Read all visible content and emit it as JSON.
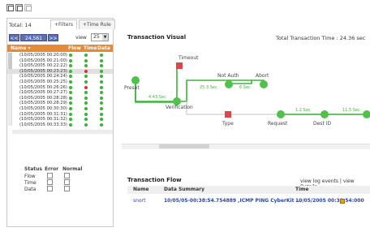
{
  "toolbar": {
    "icons": [
      "window-icon",
      "window-icon",
      "window-icon-disabled"
    ]
  },
  "left": {
    "total_label": "Total: 14",
    "tabs": [
      {
        "label": "+Filters"
      },
      {
        "label": "+Time Rule"
      }
    ],
    "pager": {
      "prev": "<<",
      "page": "24,561",
      "next": ">>"
    },
    "view": {
      "label": "view",
      "value": "25",
      "arrow": "▼"
    },
    "table_header": {
      "name": "Name ▾",
      "flow": "Flow",
      "time": "Time",
      "data": "Data"
    },
    "rows": [
      {
        "ts": "(10/05/2005 00:20:00)",
        "dots": [
          "#36b536",
          "#36b536",
          "#36b536"
        ],
        "selected": false
      },
      {
        "ts": "(10/05/2005 00:21:00)",
        "dots": [
          "#36b536",
          "#36b536",
          "#36b536"
        ],
        "selected": false
      },
      {
        "ts": "(10/05/2005 00:22:22)",
        "dots": [
          "#36b536",
          "#36b536",
          "#36b536"
        ],
        "selected": false
      },
      {
        "ts": "(10/05/2005 00:23:23)",
        "dots": [
          "#36b536",
          "#e03030",
          "#36b536"
        ],
        "selected": true
      },
      {
        "ts": "(10/05/2005 00:24:24)",
        "dots": [
          "#36b536",
          "#36b536",
          "#36b536"
        ],
        "selected": false
      },
      {
        "ts": "(10/05/2005 00:25:25)",
        "dots": [
          "#36b536",
          "#36b536",
          "#36b536"
        ],
        "selected": false
      },
      {
        "ts": "(10/05/2005 00:26:26)",
        "dots": [
          "#36b536",
          "#e03030",
          "#36b536"
        ],
        "selected": false
      },
      {
        "ts": "(10/05/2005 00:27:27)",
        "dots": [
          "#36b536",
          "#36b536",
          "#36b536"
        ],
        "selected": false
      },
      {
        "ts": "(10/05/2005 00:28:28)",
        "dots": [
          "#36b536",
          "#36b536",
          "#36b536"
        ],
        "selected": false
      },
      {
        "ts": "(10/05/2005 00:28:29)",
        "dots": [
          "#36b536",
          "#36b536",
          "#36b536"
        ],
        "selected": false
      },
      {
        "ts": "(10/05/2005 00:30:30)",
        "dots": [
          "#36b536",
          "#36b536",
          "#36b536"
        ],
        "selected": false
      },
      {
        "ts": "(10/05/2005 00:31:31)",
        "dots": [
          "#36b536",
          "#36b536",
          "#36b536"
        ],
        "selected": false
      },
      {
        "ts": "(10/05/2005 00:31:32)",
        "dots": [
          "#36b536",
          "#36b536",
          "#36b536"
        ],
        "selected": false
      },
      {
        "ts": "(10/05/2005 00:33:33)",
        "dots": [
          "#36b536",
          "#36b536",
          "#36b536"
        ],
        "selected": false
      }
    ],
    "legend": {
      "status": "Status",
      "error": "Error",
      "normal": "Normal",
      "items": [
        "Flow",
        "Time",
        "Data"
      ]
    }
  },
  "visual": {
    "title": "Transaction Visual",
    "total_time": "Total Transaction Time : 24.36 sec",
    "nodes": {
      "preset": "Preset",
      "timeout": "Timeout",
      "verification": "Verification",
      "not_auth": "Not Auth",
      "abort": "Abort",
      "type": "Type",
      "request": "Request",
      "dest_id": "Dest ID"
    },
    "edges": {
      "e1": "4.43 Sec",
      "e2": "25.3 Sec",
      "e3": "6 Sec",
      "e4": "1.2 Sec",
      "e5": "11.5 Sec"
    }
  },
  "flow": {
    "title": "Transaction Flow",
    "links": "view log events | view Details",
    "columns": {
      "name": "Name",
      "data": "Data Summary",
      "time": "Time"
    },
    "row": {
      "name": "snort",
      "data": "10/05/05-00:38:54.754889 ,ICMP PING CyberKit ...",
      "time": "10/05/2005 00:30:54:000"
    }
  },
  "colors": {
    "accent_orange": "#e58a36",
    "pager_blue": "#5c6fb3",
    "node_green": "#4fc24a",
    "node_red": "#e04545",
    "edge_green": "#3ab53a"
  }
}
